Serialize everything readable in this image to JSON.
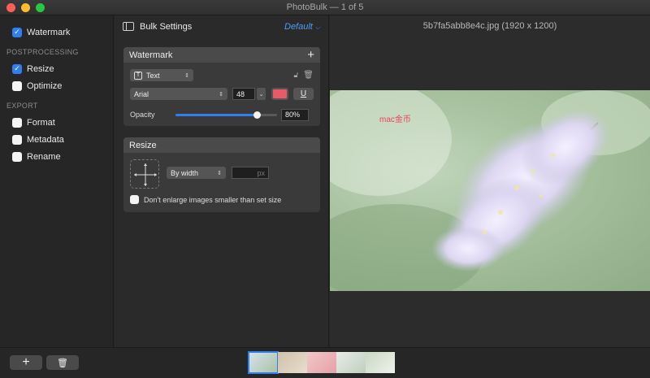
{
  "window": {
    "title": "PhotoBulk — 1 of 5"
  },
  "sidebar": {
    "items_top": [
      {
        "label": "Watermark",
        "checked": true
      }
    ],
    "postprocessing_label": "POSTPROCESSING",
    "postprocessing": [
      {
        "label": "Resize",
        "checked": true
      },
      {
        "label": "Optimize",
        "checked": false
      }
    ],
    "export_label": "EXPORT",
    "export": [
      {
        "label": "Format",
        "checked": false
      },
      {
        "label": "Metadata",
        "checked": false
      },
      {
        "label": "Rename",
        "checked": false
      }
    ]
  },
  "settings": {
    "title": "Bulk Settings",
    "preset": "Default",
    "watermark": {
      "header": "Watermark",
      "type": "Text",
      "font": "Arial",
      "size": "48",
      "color": "#e85a68",
      "underline_label": "U",
      "opacity_label": "Opacity",
      "opacity_value": "80%",
      "opacity_fraction": 0.8
    },
    "resize": {
      "header": "Resize",
      "mode": "By width",
      "unit": "px",
      "dont_enlarge": "Don't enlarge images smaller than set size",
      "dont_enlarge_checked": false
    }
  },
  "preview": {
    "filename": "5b7fa5abb8e4c.jpg (1920 x 1200)",
    "watermark_text": "mac金币"
  },
  "colors": {
    "accent": "#2f7ff0",
    "preset": "#4d9cf8",
    "watermark": "#e8455a"
  }
}
